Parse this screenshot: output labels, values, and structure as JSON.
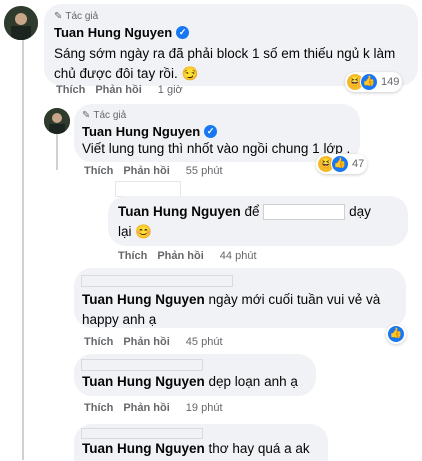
{
  "author_tag": "Tác giả",
  "comments": [
    {
      "name": "Tuan Hung Nguyen",
      "text_line1": "Sáng sớm ngày ra đã phải block 1 số em thiếu ngủ k làm",
      "text_line2": "chủ được đôi tay rồi. 😏",
      "like": "Thích",
      "reply": "Phản hồi",
      "time": "1 giờ",
      "reaction_count": "149"
    },
    {
      "name": "Tuan Hung Nguyen",
      "text": "Viết lung tung thì nhốt vào ngồi chung 1 lớp .",
      "like": "Thích",
      "reply": "Phản hồi",
      "time": "55 phút",
      "reaction_count": "47"
    },
    {
      "name": "Tuan Hung Nguyen",
      "text_before": "để",
      "text_after": "dạy",
      "text_line2": "lại 😊",
      "like": "Thích",
      "reply": "Phản hồi",
      "time": "44 phút"
    },
    {
      "name": "Tuan Hung Nguyen",
      "text_line1": "ngày mới cuối tuần vui vẻ và",
      "text_line2": "happy anh ạ",
      "like": "Thích",
      "reply": "Phản hồi",
      "time": "45 phút"
    },
    {
      "name": "Tuan Hung Nguyen",
      "text": "dẹp loạn anh ạ",
      "like": "Thích",
      "reply": "Phản hồi",
      "time": "19 phút"
    },
    {
      "name": "Tuan Hung Nguyen",
      "text": "thơ hay quá a ak"
    }
  ],
  "icons": {
    "pencil": "pencil-icon",
    "verified": "verified-badge-icon",
    "haha": "haha-reaction-icon",
    "like": "like-reaction-icon"
  },
  "colors": {
    "bubble": "#f0f2f5",
    "like_blue": "#1877f2",
    "haha_yellow": "#f7b928",
    "meta_gray": "#65676b"
  }
}
